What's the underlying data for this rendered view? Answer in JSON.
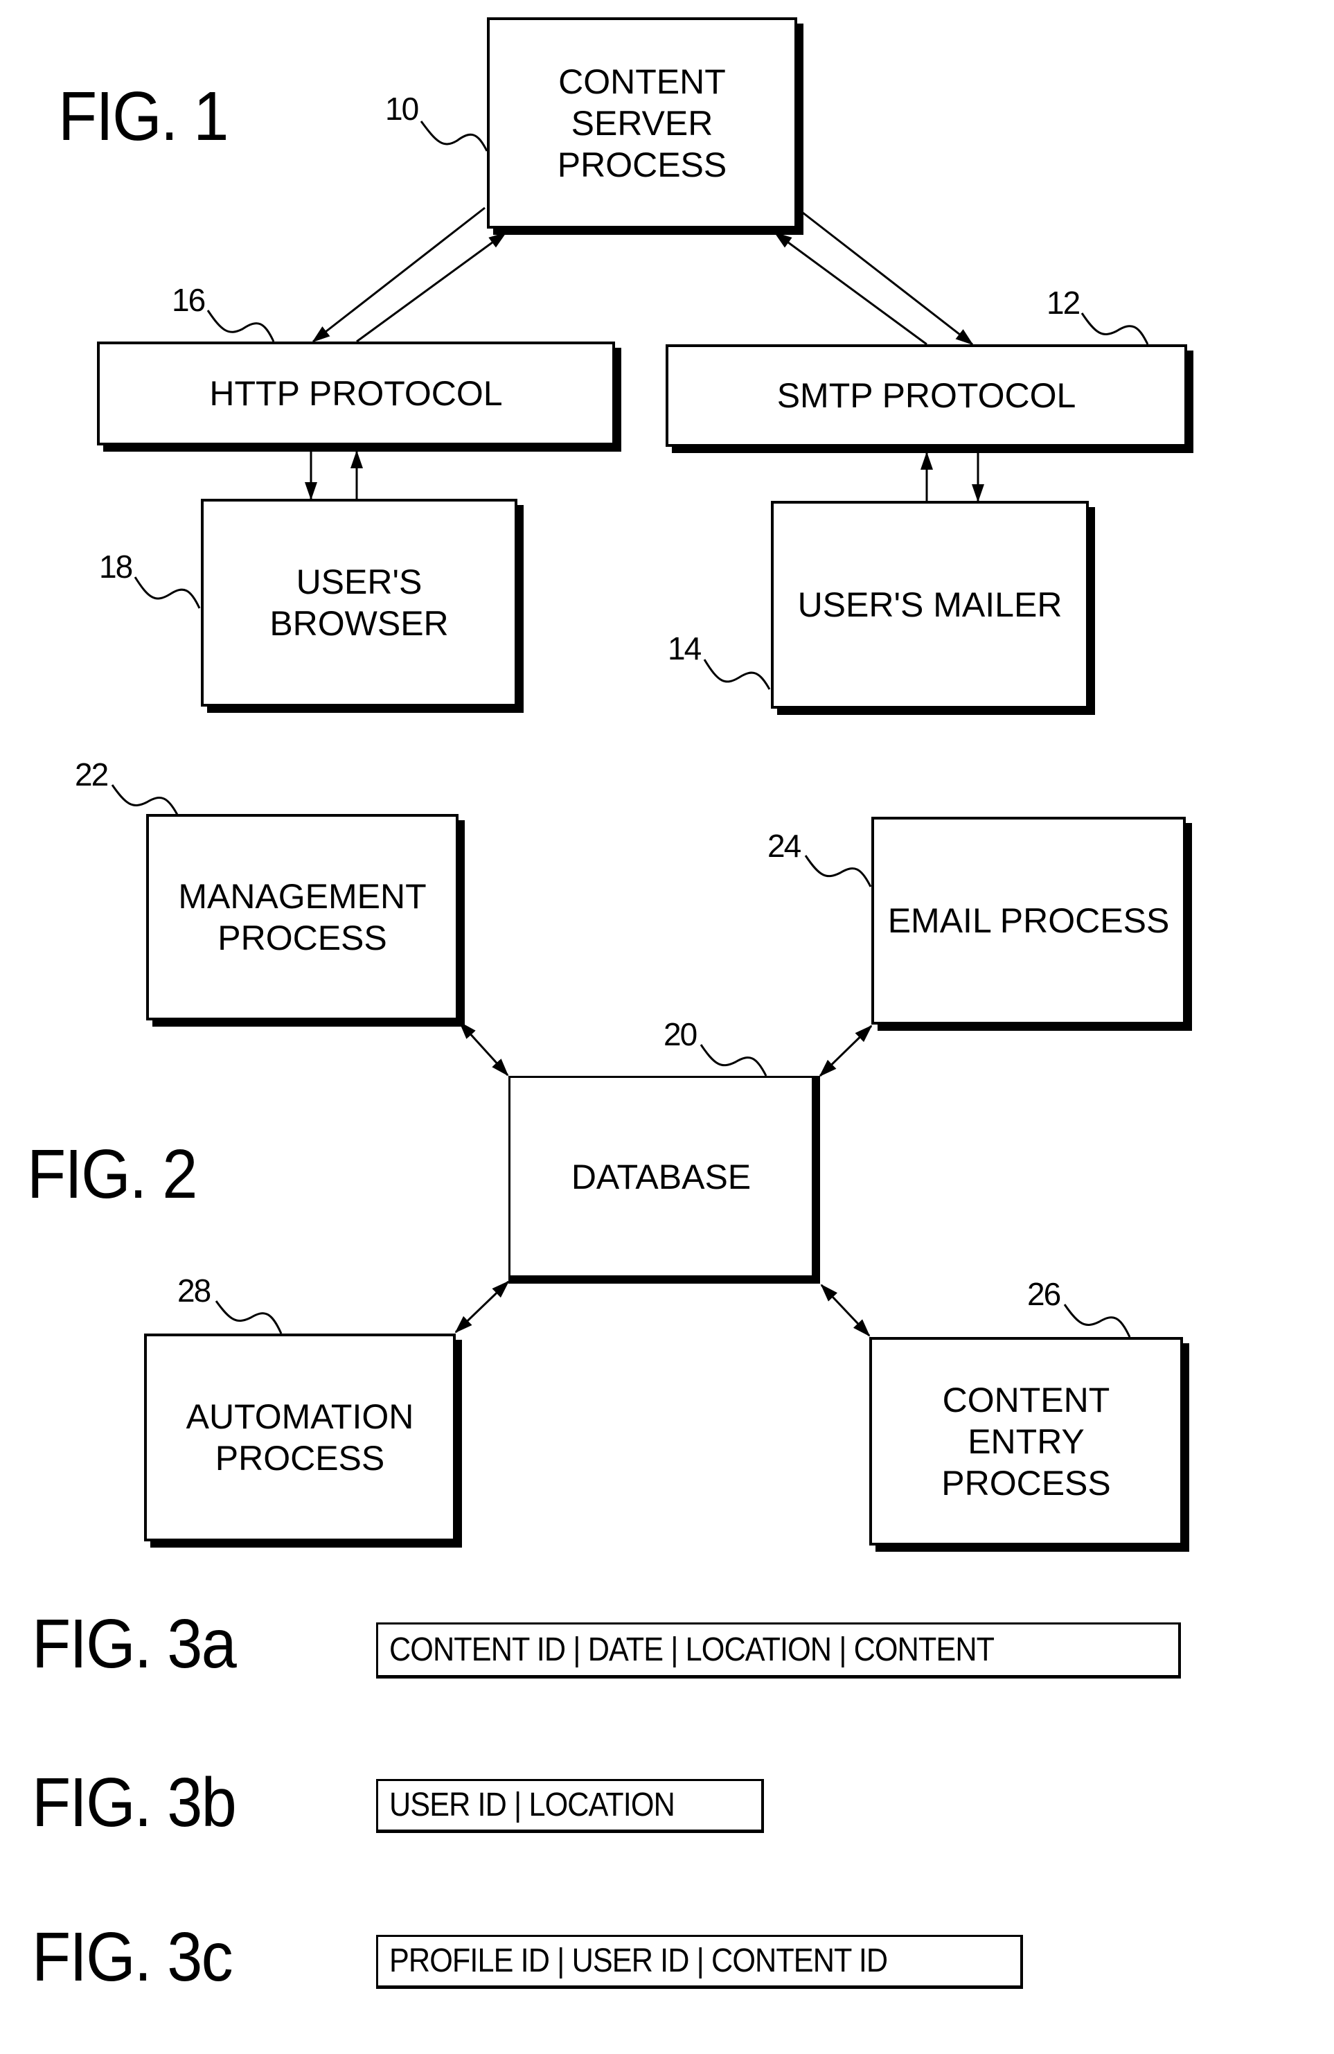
{
  "figures": {
    "fig1": {
      "label": "FIG. 1",
      "nodes": {
        "content_server": {
          "ref": "10",
          "text": "CONTENT\nSERVER\nPROCESS"
        },
        "http": {
          "ref": "16",
          "text": "HTTP PROTOCOL"
        },
        "smtp": {
          "ref": "12",
          "text": "SMTP PROTOCOL"
        },
        "browser": {
          "ref": "18",
          "text": "USER'S\nBROWSER"
        },
        "mailer": {
          "ref": "14",
          "text": "USER'S MAILER"
        }
      },
      "edges": [
        {
          "from": "content_server",
          "to": "http"
        },
        {
          "from": "http",
          "to": "content_server"
        },
        {
          "from": "content_server",
          "to": "smtp"
        },
        {
          "from": "smtp",
          "to": "content_server"
        },
        {
          "from": "http",
          "to": "browser"
        },
        {
          "from": "browser",
          "to": "http"
        },
        {
          "from": "smtp",
          "to": "mailer"
        },
        {
          "from": "mailer",
          "to": "smtp"
        }
      ]
    },
    "fig2": {
      "label": "FIG. 2",
      "nodes": {
        "database": {
          "ref": "20",
          "text": "DATABASE"
        },
        "management": {
          "ref": "22",
          "text": "MANAGEMENT\nPROCESS"
        },
        "email": {
          "ref": "24",
          "text": "EMAIL PROCESS"
        },
        "content_entry": {
          "ref": "26",
          "text": "CONTENT\nENTRY\nPROCESS"
        },
        "automation": {
          "ref": "28",
          "text": "AUTOMATION\nPROCESS"
        }
      },
      "edges": [
        {
          "between": [
            "management",
            "database"
          ],
          "bidirectional": true
        },
        {
          "between": [
            "email",
            "database"
          ],
          "bidirectional": true
        },
        {
          "between": [
            "automation",
            "database"
          ],
          "bidirectional": true
        },
        {
          "between": [
            "content_entry",
            "database"
          ],
          "bidirectional": true
        }
      ]
    },
    "fig3a": {
      "label": "FIG. 3a",
      "fields": [
        "CONTENT ID",
        "DATE",
        "LOCATION",
        "CONTENT"
      ],
      "record_text": "CONTENT ID | DATE | LOCATION | CONTENT"
    },
    "fig3b": {
      "label": "FIG. 3b",
      "fields": [
        "USER ID",
        "LOCATION"
      ],
      "record_text": "USER ID | LOCATION"
    },
    "fig3c": {
      "label": "FIG. 3c",
      "fields": [
        "PROFILE ID",
        "USER ID",
        "CONTENT ID"
      ],
      "record_text": "PROFILE ID | USER ID | CONTENT ID"
    }
  }
}
